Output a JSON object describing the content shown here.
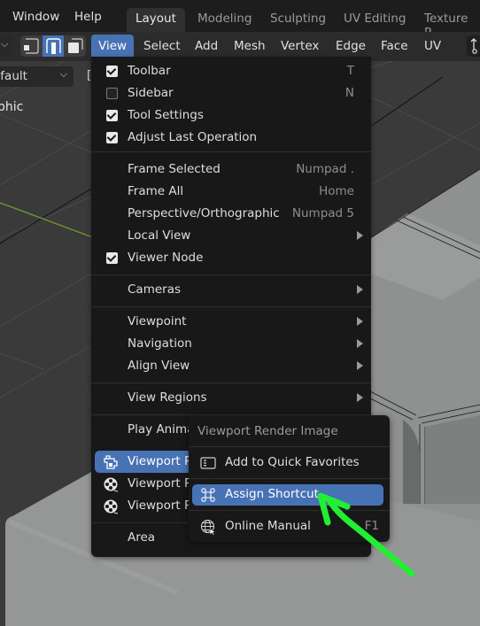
{
  "topbar": {
    "menus": [
      "Window",
      "Help"
    ],
    "workspace_tabs": [
      {
        "label": "Layout",
        "active": true
      },
      {
        "label": "Modeling",
        "active": false
      },
      {
        "label": "Sculpting",
        "active": false
      },
      {
        "label": "UV Editing",
        "active": false
      },
      {
        "label": "Texture P",
        "active": false
      }
    ]
  },
  "header": {
    "select_modes": [
      "vertex-select",
      "edge-select",
      "face-select"
    ],
    "active_select_mode": "edge-select",
    "menus": [
      {
        "label": "View",
        "active": true
      },
      {
        "label": "Select",
        "active": false
      },
      {
        "label": "Add",
        "active": false
      },
      {
        "label": "Mesh",
        "active": false
      },
      {
        "label": "Vertex",
        "active": false
      },
      {
        "label": "Edge",
        "active": false
      },
      {
        "label": "Face",
        "active": false
      },
      {
        "label": "UV",
        "active": false
      }
    ],
    "right_icon": "transform-pivot-icon"
  },
  "viewport": {
    "orientation_dropdown": "efault",
    "header_fragment": "[",
    "overlay_text": "phic",
    "accent_colors": {
      "y_axis": "#6f9a2e",
      "highlight": "#4772b3",
      "annotation_arrow": "#22ee33"
    }
  },
  "view_menu": {
    "sections": [
      {
        "items": [
          {
            "label": "Toolbar",
            "checkbox": true,
            "checked": true,
            "shortcut": "T"
          },
          {
            "label": "Sidebar",
            "checkbox": true,
            "checked": false,
            "shortcut": "N"
          },
          {
            "label": "Tool Settings",
            "checkbox": true,
            "checked": true,
            "shortcut": ""
          },
          {
            "label": "Adjust Last Operation",
            "checkbox": true,
            "checked": true,
            "shortcut": ""
          }
        ]
      },
      {
        "items": [
          {
            "label": "Frame Selected",
            "shortcut": "Numpad ."
          },
          {
            "label": "Frame All",
            "shortcut": "Home"
          },
          {
            "label": "Perspective/Orthographic",
            "shortcut": "Numpad 5"
          },
          {
            "label": "Local View",
            "submenu": true
          },
          {
            "label": "Viewer Node",
            "checkbox": true,
            "checked": true
          }
        ]
      },
      {
        "items": [
          {
            "label": "Cameras",
            "submenu": true
          }
        ]
      },
      {
        "items": [
          {
            "label": "Viewpoint",
            "submenu": true
          },
          {
            "label": "Navigation",
            "submenu": true
          },
          {
            "label": "Align View",
            "submenu": true
          }
        ]
      },
      {
        "items": [
          {
            "label": "View Regions",
            "submenu": true
          }
        ]
      },
      {
        "items": [
          {
            "label": "Play Anima",
            "icon": ""
          },
          {
            "label": "Viewport R",
            "icon": "render-still-icon",
            "highlighted": true
          },
          {
            "label": "Viewport R",
            "icon": "render-animation-icon"
          },
          {
            "label": "Viewport R",
            "icon": "render-animation-icon"
          }
        ]
      },
      {
        "items": [
          {
            "label": "Area",
            "submenu": false
          }
        ]
      }
    ]
  },
  "context_menu": {
    "title": "Viewport Render Image",
    "items": [
      {
        "label": "Add to Quick Favorites",
        "icon": "quick-favorites-icon",
        "shortcut": ""
      },
      {
        "label": "Assign Shortcut",
        "icon": "keyboard-shortcut-icon",
        "shortcut": "",
        "highlighted": true
      },
      {
        "label": "Online Manual",
        "icon": "online-manual-icon",
        "shortcut": "F1"
      }
    ]
  }
}
